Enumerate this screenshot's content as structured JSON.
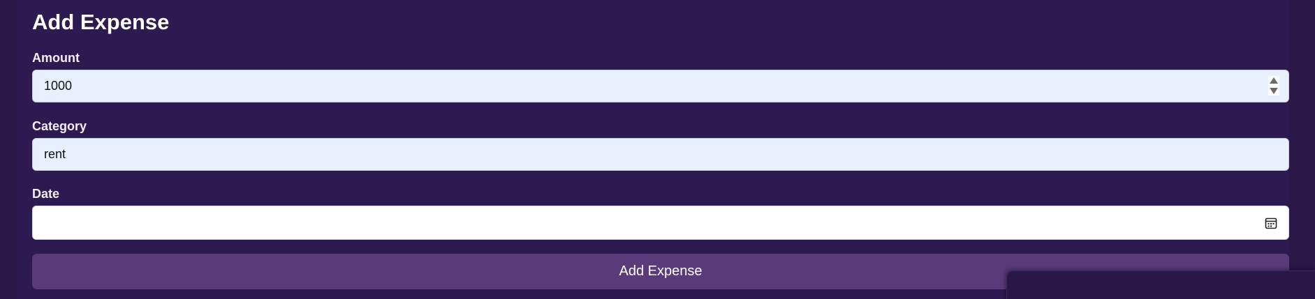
{
  "form": {
    "title": "Add Expense",
    "fields": {
      "amount": {
        "label": "Amount",
        "value": "1000"
      },
      "category": {
        "label": "Category",
        "value": "rent"
      },
      "date": {
        "label": "Date",
        "value": ""
      }
    },
    "submit_label": "Add Expense"
  },
  "icons": {
    "spinner": "spinner-arrows-icon",
    "calendar": "calendar-icon"
  },
  "colors": {
    "background": "#2d1a50",
    "input_fill": "#e8effd",
    "date_fill": "#ffffff",
    "button": "#5b3a7b"
  }
}
